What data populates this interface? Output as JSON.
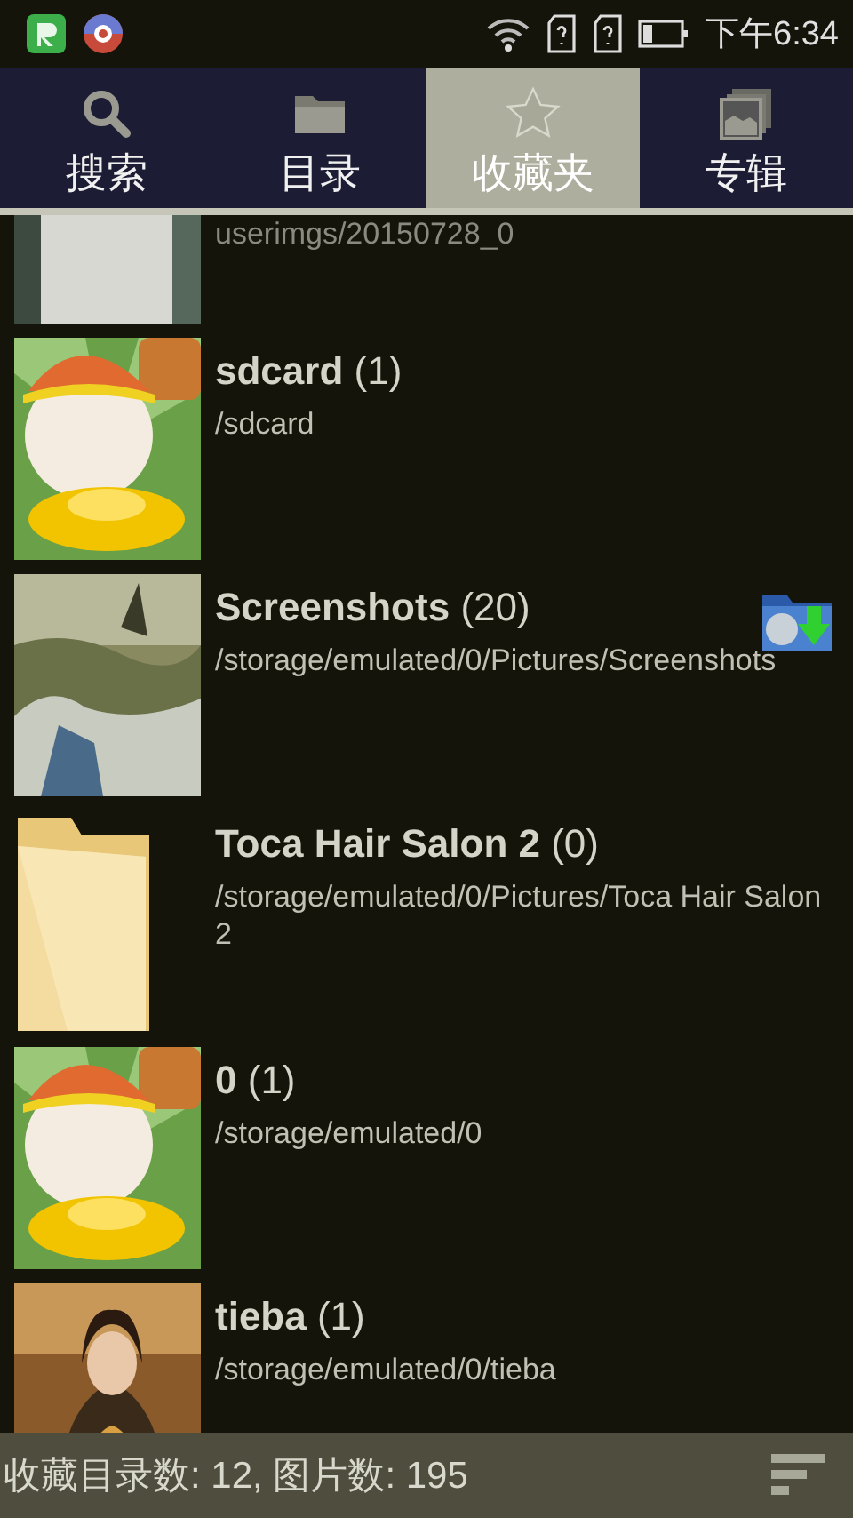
{
  "status_bar": {
    "time": "下午6:34"
  },
  "tabs": [
    {
      "label": "搜索",
      "selected": false
    },
    {
      "label": "目录",
      "selected": false
    },
    {
      "label": "收藏夹",
      "selected": true
    },
    {
      "label": "专辑",
      "selected": false
    }
  ],
  "folders": [
    {
      "path": "userimgs/20150728_0",
      "kind": "picture",
      "partial": true
    },
    {
      "title": "sdcard",
      "count": "(1)",
      "path": "/sdcard",
      "kind": "picture",
      "partial": false
    },
    {
      "title": "Screenshots",
      "count": "(20)",
      "path": "/storage/emulated/0/Pictures/Screenshots",
      "kind": "picture",
      "partial": false,
      "download_badge": true
    },
    {
      "title": "Toca Hair Salon 2",
      "count": "(0)",
      "path": "/storage/emulated/0/Pictures/Toca Hair Salon 2",
      "kind": "folder",
      "partial": false
    },
    {
      "title": "0",
      "count": "(1)",
      "path": "/storage/emulated/0",
      "kind": "picture",
      "partial": false
    },
    {
      "title": "tieba",
      "count": "(1)",
      "path": "/storage/emulated/0/tieba",
      "kind": "picture",
      "partial": false
    }
  ],
  "footer": {
    "summary": "收藏目录数: 12, 图片数: 195"
  }
}
